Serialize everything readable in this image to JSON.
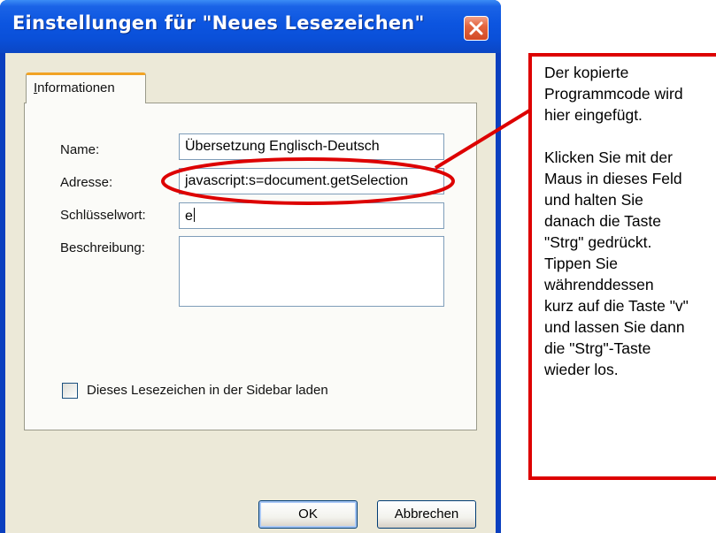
{
  "dialog": {
    "title": "Einstellungen für \"Neues Lesezeichen\"",
    "tab": {
      "prefix": "I",
      "rest": "nformationen"
    },
    "labels": {
      "name": "Name:",
      "address": "Adresse:",
      "keyword": "Schlüsselwort:",
      "description": "Beschreibung:"
    },
    "fields": {
      "name": "Übersetzung Englisch-Deutsch",
      "address": "javascript:s=document.getSelection",
      "keyword": "e",
      "description": ""
    },
    "checkbox_label": "Dieses Lesezeichen in der Sidebar laden",
    "buttons": {
      "ok": "OK",
      "cancel": "Abbrechen"
    }
  },
  "annotation": {
    "paragraph1": [
      "Der kopierte",
      "Programmcode wird",
      "hier eingefügt."
    ],
    "paragraph2": [
      "Klicken Sie mit der",
      "Maus in dieses Feld",
      "und halten Sie",
      "danach die Taste",
      "\"Strg\" gedrückt.",
      "Tippen Sie",
      "währenddessen",
      "kurz auf die Taste \"v\"",
      "und lassen Sie dann",
      "die \"Strg\"-Taste",
      "wieder los."
    ],
    "color": "#dd0000"
  },
  "icons": {
    "close": "close-icon",
    "checkbox": "checkbox-unchecked"
  }
}
